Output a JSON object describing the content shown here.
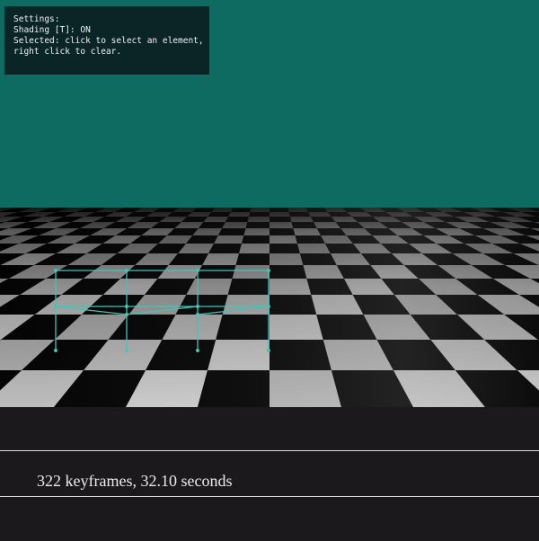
{
  "colors": {
    "sky": "#0e6b62",
    "background": "#1b191b",
    "overlay": "#0b2527",
    "skeleton": "#41c6b6",
    "rule": "#d9d9d9"
  },
  "overlay": {
    "settings_label": "Settings:",
    "shading_label": "Shading [T]: ON",
    "selected_line1": "Selected: click to select an element,",
    "selected_line2": "right click to clear."
  },
  "timeline": {
    "status": "322 keyframes, 32.10 seconds"
  }
}
